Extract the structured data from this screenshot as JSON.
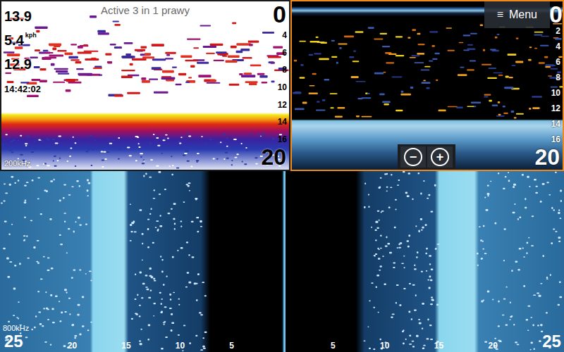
{
  "title": "Active 3 in 1 prawy",
  "readouts": [
    {
      "value": "13.9"
    },
    {
      "value": "5.4",
      "unit": "kph"
    },
    {
      "value": "12.9"
    },
    {
      "value": "14:42:02"
    }
  ],
  "sonar": {
    "frequency": "200kHz",
    "range_top": "0",
    "range_bottom": "20",
    "depth_ticks": [
      "4",
      "6",
      "8",
      "10",
      "12",
      "14",
      "16"
    ],
    "selected": false
  },
  "downscan": {
    "range_top": "0",
    "range_bottom": "20",
    "depth_ticks": [
      "2",
      "4",
      "6",
      "8",
      "10",
      "12",
      "14",
      "16"
    ],
    "selected": true
  },
  "menu_button": {
    "icon": "≡",
    "label": "Menu"
  },
  "zoom": [
    {
      "label": "−"
    },
    {
      "label": "+"
    }
  ],
  "sidescan": {
    "frequency": "800kHz",
    "left_ticks": [
      "25",
      "20",
      "15",
      "10",
      "5"
    ],
    "right_ticks": [
      "5",
      "10",
      "15",
      "20",
      "25"
    ]
  }
}
